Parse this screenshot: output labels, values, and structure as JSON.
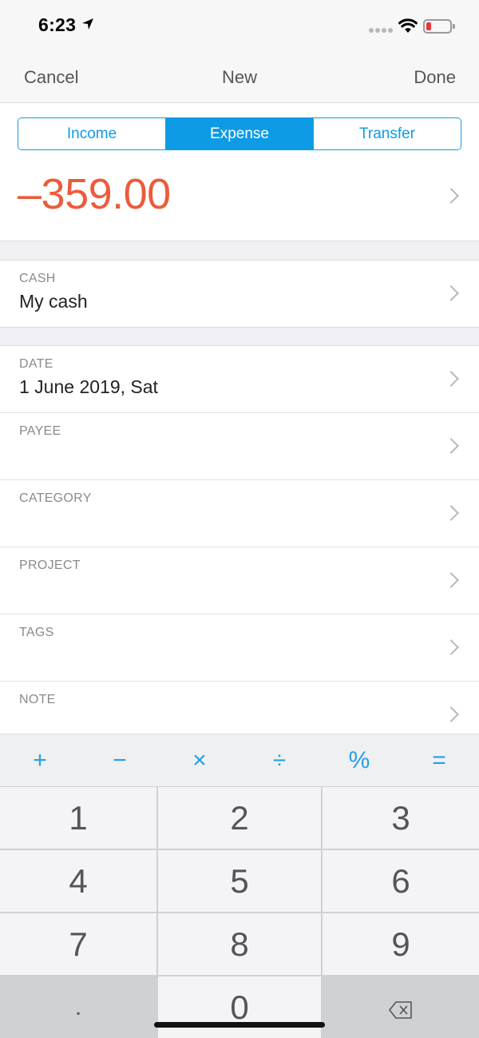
{
  "status_bar": {
    "time": "6:23",
    "icons": [
      "location-arrow-icon",
      "cellular-signal-icon",
      "wifi-icon",
      "battery-low-icon"
    ],
    "battery_color": "#e8383d"
  },
  "nav": {
    "cancel_label": "Cancel",
    "title": "New",
    "done_label": "Done"
  },
  "type_segment": {
    "options": [
      "Income",
      "Expense",
      "Transfer"
    ],
    "selected": "Expense",
    "accent_color": "#0e9be6"
  },
  "amount": {
    "value": "–359.00",
    "color": "#ec5b3d"
  },
  "fields": {
    "account": {
      "label": "CASH",
      "value": "My cash"
    },
    "date": {
      "label": "DATE",
      "value": "1 June 2019, Sat"
    },
    "payee": {
      "label": "PAYEE",
      "value": ""
    },
    "category": {
      "label": "CATEGORY",
      "value": ""
    },
    "project": {
      "label": "PROJECT",
      "value": ""
    },
    "tags": {
      "label": "TAGS",
      "value": ""
    },
    "note": {
      "label": "NOTE",
      "value": ""
    }
  },
  "operators": [
    "+",
    "−",
    "×",
    "÷",
    "%",
    "="
  ],
  "keypad": {
    "keys": [
      "1",
      "2",
      "3",
      "4",
      "5",
      "6",
      "7",
      "8",
      "9",
      ".",
      "0"
    ],
    "backspace_icon": "backspace-icon"
  }
}
